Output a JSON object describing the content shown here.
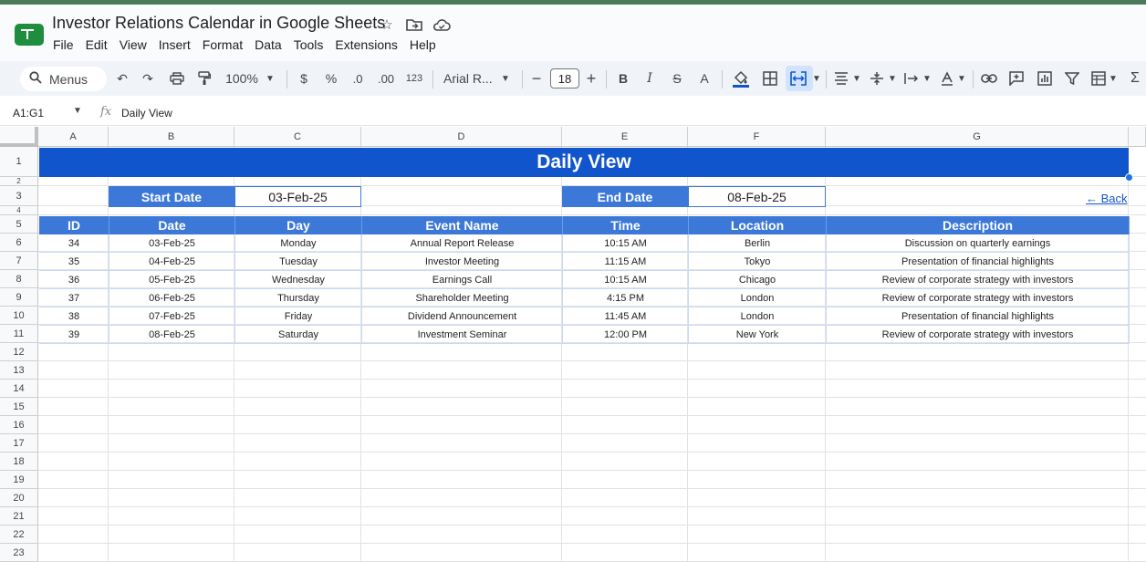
{
  "window": {
    "doc_title": "Investor Relations Calendar in Google Sheets",
    "title_icons": [
      "star-icon",
      "move-folder-icon",
      "cloud-status-icon"
    ],
    "menu": [
      "File",
      "Edit",
      "View",
      "Insert",
      "Format",
      "Data",
      "Tools",
      "Extensions",
      "Help"
    ]
  },
  "toolbar": {
    "menus_label": "Menus",
    "zoom": "100%",
    "currency": "$",
    "percent": "%",
    "decrease_decimal": ".0",
    "increase_decimal": ".00",
    "number_format": "123",
    "font": "Arial R...",
    "font_size": "18",
    "bold": "B",
    "italic": "I",
    "strike": "S",
    "text_color": "A",
    "fill_color": "#1155cc"
  },
  "formula_bar": {
    "name_box": "A1:G1",
    "fx": "fx",
    "content": "Daily View"
  },
  "sheet": {
    "columns": [
      "A",
      "B",
      "C",
      "D",
      "E",
      "F",
      "G"
    ],
    "rows": [
      "1",
      "2",
      "3",
      "4",
      "5",
      "6",
      "7",
      "8",
      "9",
      "10",
      "11",
      "12",
      "13",
      "14",
      "15",
      "16",
      "17",
      "18",
      "19",
      "20",
      "21",
      "22",
      "23"
    ],
    "title": "Daily View",
    "start_label": "Start Date",
    "start_value": "03-Feb-25",
    "end_label": "End Date",
    "end_value": "08-Feb-25",
    "back_link": "← Back",
    "headers": [
      "ID",
      "Date",
      "Day",
      "Event Name",
      "Time",
      "Location",
      "Description"
    ],
    "events": [
      [
        "34",
        "03-Feb-25",
        "Monday",
        "Annual Report Release",
        "10:15 AM",
        "Berlin",
        "Discussion on quarterly earnings"
      ],
      [
        "35",
        "04-Feb-25",
        "Tuesday",
        "Investor Meeting",
        "11:15 AM",
        "Tokyo",
        "Presentation of financial highlights"
      ],
      [
        "36",
        "05-Feb-25",
        "Wednesday",
        "Earnings Call",
        "10:15 AM",
        "Chicago",
        "Review of corporate strategy with investors"
      ],
      [
        "37",
        "06-Feb-25",
        "Thursday",
        "Shareholder Meeting",
        "4:15 PM",
        "London",
        "Review of corporate strategy with investors"
      ],
      [
        "38",
        "07-Feb-25",
        "Friday",
        "Dividend Announcement",
        "11:45 AM",
        "London",
        "Presentation of financial highlights"
      ],
      [
        "39",
        "08-Feb-25",
        "Saturday",
        "Investment Seminar",
        "12:00 PM",
        "New York",
        "Review of corporate strategy with investors"
      ]
    ],
    "colors": {
      "title_band": "#1155cc",
      "header": "#3c78d8",
      "link": "#1155cc"
    }
  }
}
